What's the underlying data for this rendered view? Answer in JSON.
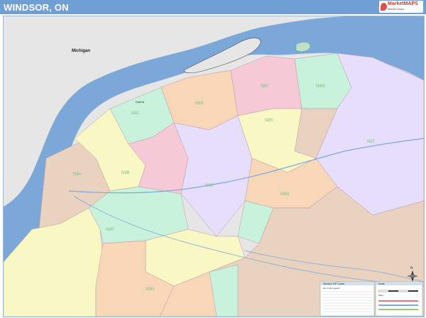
{
  "header": {
    "title": "WINDSOR, ON",
    "background": "#6f9fd4"
  },
  "logo": {
    "line1": "MarketMAPS",
    "line2": "Market Maps",
    "color": "#c0392b"
  },
  "map": {
    "water_label": "Michigan",
    "poi_label": "Detroit",
    "compass": "N",
    "colors": {
      "water": "#7ba7d9",
      "land_us": "#e6e6e6",
      "pink": "#f6c9d6",
      "peach": "#f8d6b8",
      "yellow": "#f9f7c4",
      "green": "#c9f2dc",
      "lavender": "#e6defa",
      "tan": "#e9d2c0"
    },
    "postal_labels": [
      "N9A",
      "N9B",
      "N9C",
      "N8X",
      "N8Y",
      "N8W",
      "N8S",
      "N8T",
      "N9E",
      "N9G",
      "N8P",
      "N9H"
    ]
  },
  "legend": {
    "title": "Windsor ZIP Codes",
    "subtitle": "Zip Code Legend"
  },
  "scale_box": {
    "title": "Scale",
    "units": "Miles"
  }
}
